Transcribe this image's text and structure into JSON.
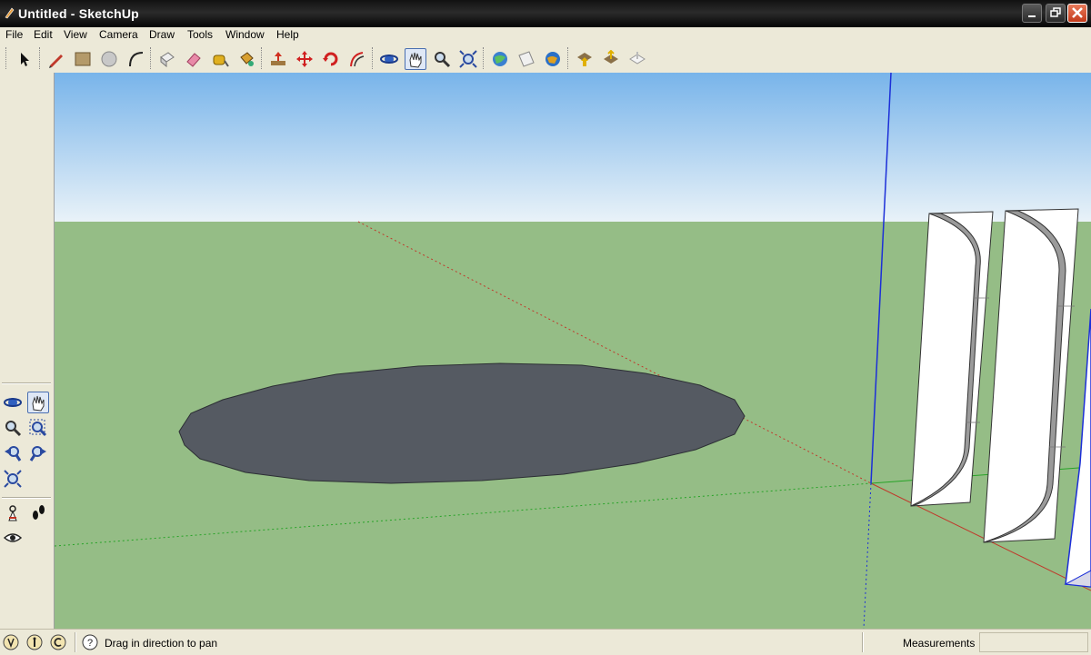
{
  "window": {
    "title": "Untitled - SketchUp"
  },
  "menu": [
    "File",
    "Edit",
    "View",
    "Camera",
    "Draw",
    "Tools",
    "Window",
    "Help"
  ],
  "toolbar": {
    "tools": [
      "select-icon",
      "pencil-icon",
      "rectangle-icon",
      "circle-icon",
      "arc-icon",
      "make-component-icon",
      "eraser-icon",
      "tape-measure-icon",
      "paint-bucket-icon",
      "push-pull-icon",
      "move-icon",
      "rotate-icon",
      "offset-icon",
      "orbit-icon",
      "pan-icon",
      "zoom-icon",
      "zoom-extents-icon",
      "get-models-icon",
      "share-model-icon",
      "google-earth-icon",
      "get-current-view-icon",
      "toggle-terrain-icon",
      "place-model-icon"
    ],
    "active_tool": "pan-icon"
  },
  "left_palette": {
    "tools": [
      "orbit-icon",
      "pan-icon",
      "zoom-icon",
      "zoom-window-icon",
      "previous-view-icon",
      "next-view-icon",
      "zoom-extents-icon",
      "position-camera-icon",
      "walk-icon",
      "look-around-icon"
    ],
    "active_tool": "pan-icon"
  },
  "statusbar": {
    "hint": "Drag in direction to pan",
    "measurements_label": "Measurements",
    "measurements_value": ""
  },
  "colors": {
    "sky_top": "#78b4ea",
    "sky_bottom": "#e9f2f8",
    "ground": "#95bd86",
    "disc": "#555a62",
    "axis_red": "#c0392b",
    "axis_green": "#27a327",
    "axis_blue": "#1c2fd8"
  }
}
